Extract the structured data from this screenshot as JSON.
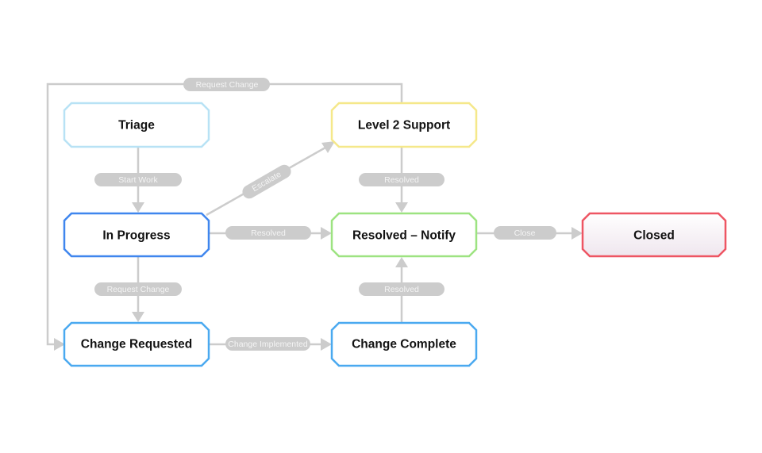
{
  "diagram": {
    "nodes": [
      {
        "id": "triage",
        "label": "Triage",
        "color": "#b8e2f5",
        "fill": "#ffffff"
      },
      {
        "id": "level2",
        "label": "Level 2 Support",
        "color": "#f5e88a",
        "fill": "#ffffff"
      },
      {
        "id": "inprogress",
        "label": "In Progress",
        "color": "#3f86ee",
        "fill": "#ffffff"
      },
      {
        "id": "resolved",
        "label": "Resolved – Notify",
        "color": "#9de381",
        "fill": "#ffffff"
      },
      {
        "id": "closed",
        "label": "Closed",
        "color": "#ee5563",
        "fill": "#f4edf3"
      },
      {
        "id": "changereq",
        "label": "Change Requested",
        "color": "#4aa9f0",
        "fill": "#ffffff"
      },
      {
        "id": "changecomplete",
        "label": "Change Complete",
        "color": "#4aa9f0",
        "fill": "#ffffff"
      }
    ],
    "edges": [
      {
        "from": "triage",
        "to": "inprogress",
        "label": "Start Work"
      },
      {
        "from": "inprogress",
        "to": "level2",
        "label": "Escalate"
      },
      {
        "from": "inprogress",
        "to": "resolved",
        "label": "Resolved"
      },
      {
        "from": "level2",
        "to": "resolved",
        "label": "Resolved"
      },
      {
        "from": "resolved",
        "to": "closed",
        "label": "Close"
      },
      {
        "from": "inprogress",
        "to": "changereq",
        "label": "Request Change"
      },
      {
        "from": "changereq",
        "to": "changecomplete",
        "label": "Change Implemented"
      },
      {
        "from": "changecomplete",
        "to": "resolved",
        "label": "Resolved"
      },
      {
        "from": "level2",
        "to": "changereq",
        "label": "Request Change"
      }
    ]
  }
}
